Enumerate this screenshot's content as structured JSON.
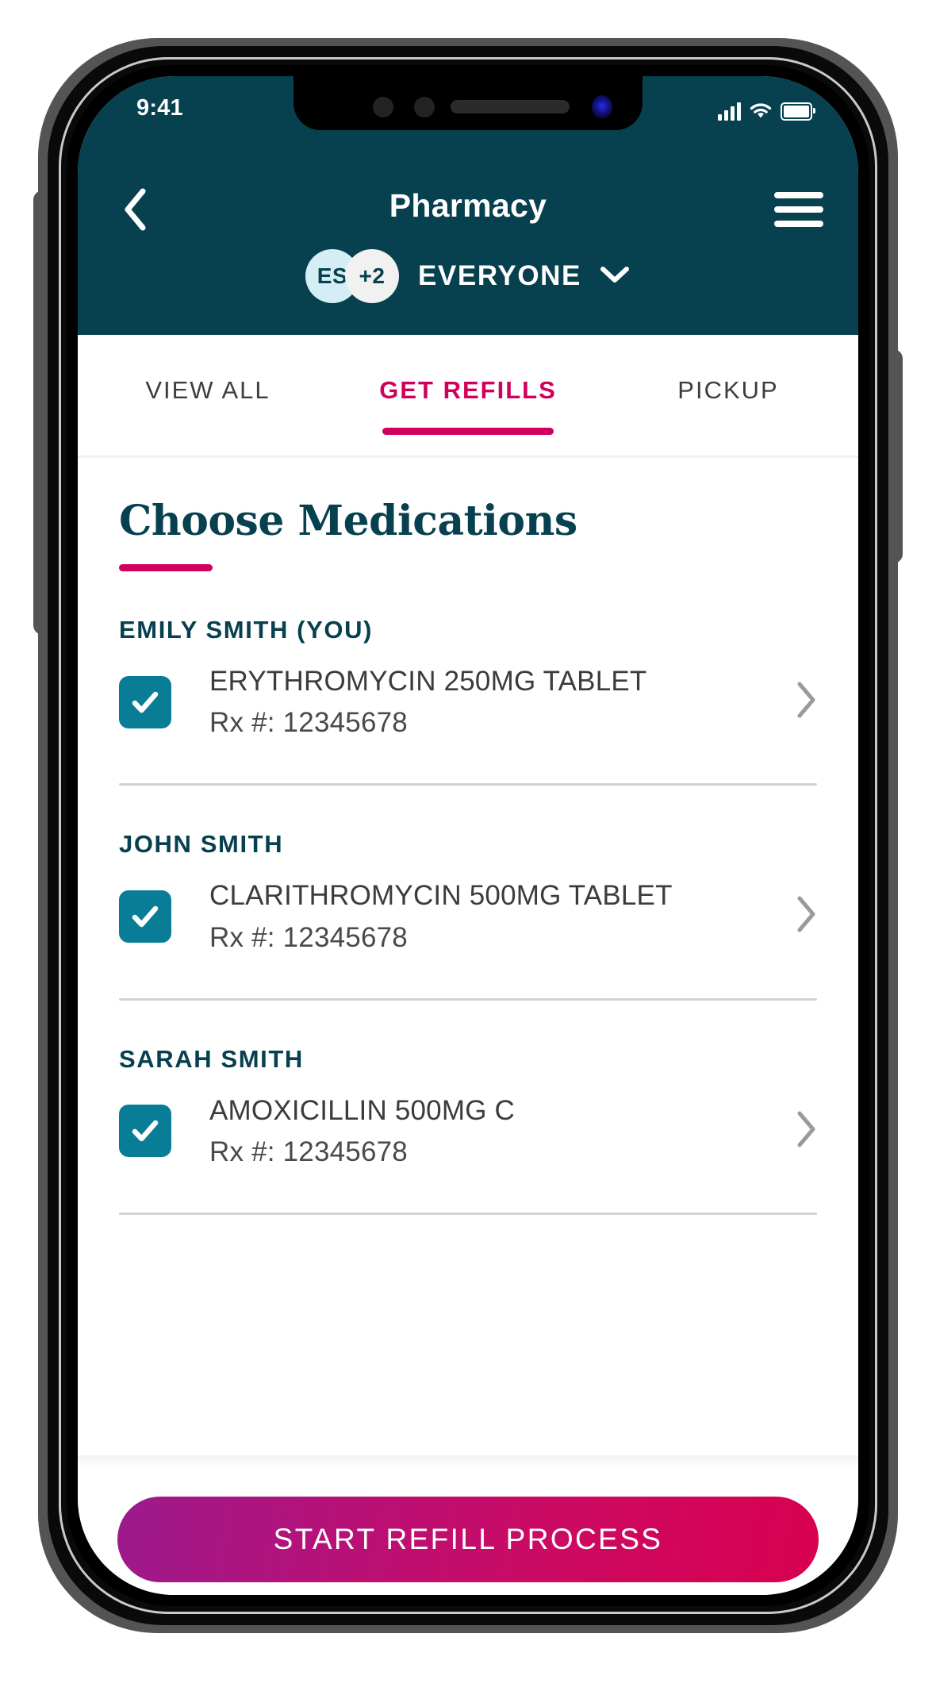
{
  "status_bar": {
    "time": "9:41",
    "cellular_icon": "signal-bars-icon",
    "wifi_icon": "wifi-icon",
    "battery_icon": "battery-icon"
  },
  "header": {
    "back_icon": "back-chevron-icon",
    "title": "Pharmacy",
    "menu_icon": "hamburger-menu-icon",
    "family_selector": {
      "avatars": [
        {
          "initials": "ES",
          "color": "#d5eef5"
        },
        {
          "initials": "+2",
          "color": "#f1f1f1"
        }
      ],
      "label": "EVERYONE",
      "dropdown_icon": "chevron-down-icon"
    },
    "background_color": "#07404f"
  },
  "tabs": [
    {
      "label": "VIEW ALL",
      "active": false
    },
    {
      "label": "GET REFILLS",
      "active": true
    },
    {
      "label": "PICKUP",
      "active": false
    }
  ],
  "main": {
    "heading": "Choose Medications",
    "accent_color": "#d2005a",
    "sections": [
      {
        "person": "EMILY SMITH (YOU)",
        "medications": [
          {
            "name": "ERYTHROMYCIN 250MG TABLET",
            "rx": "Rx #: 12345678",
            "checked": true,
            "checkbox_icon": "checkmark-icon",
            "chevron_icon": "chevron-right-icon"
          }
        ]
      },
      {
        "person": "JOHN SMITH",
        "medications": [
          {
            "name": "CLARITHROMYCIN 500MG TABLET",
            "rx": "Rx #: 12345678",
            "checked": true,
            "checkbox_icon": "checkmark-icon",
            "chevron_icon": "chevron-right-icon"
          }
        ]
      },
      {
        "person": "SARAH SMITH",
        "medications": [
          {
            "name": "AMOXICILLIN 500MG C",
            "rx": "Rx #: 12345678",
            "checked": true,
            "checkbox_icon": "checkmark-icon",
            "chevron_icon": "chevron-right-icon"
          }
        ]
      }
    ]
  },
  "footer": {
    "cta_label": "START REFILL PROCESS",
    "cta_gradient_start": "#9c1a8c",
    "cta_gradient_end": "#d8004f",
    "home_indicator": "home-indicator"
  },
  "theme": {
    "teal": "#07404f",
    "checkbox_teal": "#0a7d96",
    "crimson": "#d2005a"
  }
}
